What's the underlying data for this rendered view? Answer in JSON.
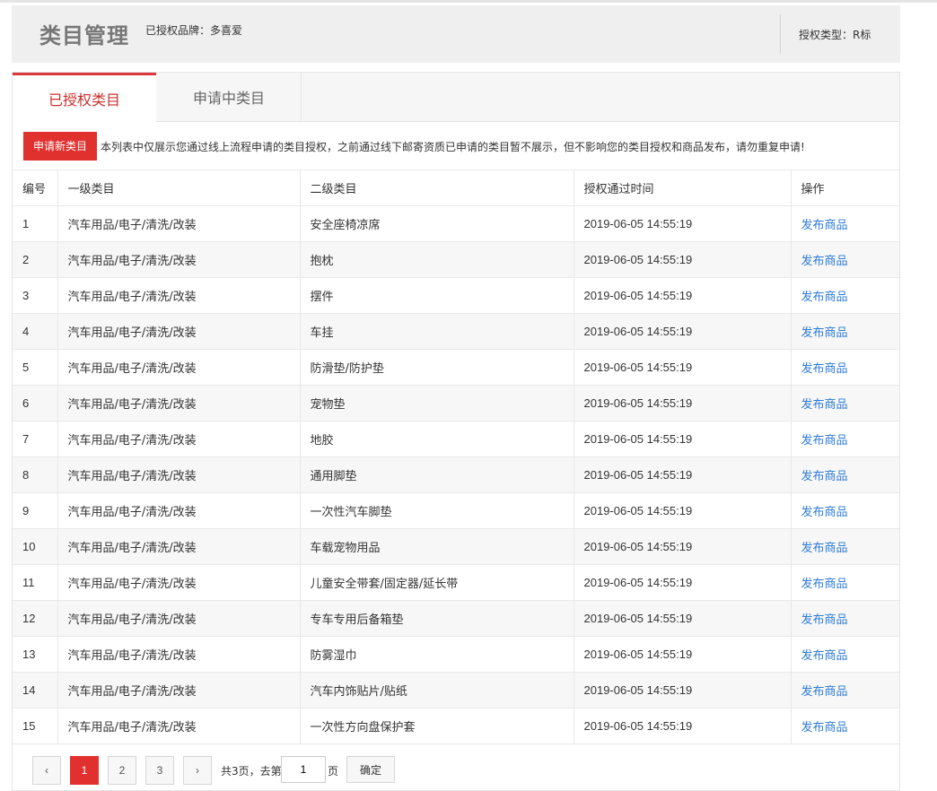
{
  "header": {
    "title": "类目管理",
    "brand_text": "已授权品牌：多喜爱",
    "auth_type_text": "授权类型：R标"
  },
  "tabs": [
    {
      "label": "已授权类目",
      "active": true
    },
    {
      "label": "申请中类目",
      "active": false
    }
  ],
  "notice": {
    "apply_button": "申请新类目",
    "text": "本列表中仅展示您通过线上流程申请的类目授权，之前通过线下邮寄资质已申请的类目暂不展示，但不影响您的类目授权和商品发布，请勿重复申请!"
  },
  "table": {
    "headers": [
      "编号",
      "一级类目",
      "二级类目",
      "授权通过时间",
      "操作"
    ],
    "rows": [
      {
        "no": "1",
        "cat1": "汽车用品/电子/清洗/改装",
        "cat2": "安全座椅凉席",
        "time": "2019-06-05 14:55:19",
        "action": "发布商品"
      },
      {
        "no": "2",
        "cat1": "汽车用品/电子/清洗/改装",
        "cat2": "抱枕",
        "time": "2019-06-05 14:55:19",
        "action": "发布商品"
      },
      {
        "no": "3",
        "cat1": "汽车用品/电子/清洗/改装",
        "cat2": "摆件",
        "time": "2019-06-05 14:55:19",
        "action": "发布商品"
      },
      {
        "no": "4",
        "cat1": "汽车用品/电子/清洗/改装",
        "cat2": "车挂",
        "time": "2019-06-05 14:55:19",
        "action": "发布商品"
      },
      {
        "no": "5",
        "cat1": "汽车用品/电子/清洗/改装",
        "cat2": "防滑垫/防护垫",
        "time": "2019-06-05 14:55:19",
        "action": "发布商品"
      },
      {
        "no": "6",
        "cat1": "汽车用品/电子/清洗/改装",
        "cat2": "宠物垫",
        "time": "2019-06-05 14:55:19",
        "action": "发布商品"
      },
      {
        "no": "7",
        "cat1": "汽车用品/电子/清洗/改装",
        "cat2": "地胶",
        "time": "2019-06-05 14:55:19",
        "action": "发布商品"
      },
      {
        "no": "8",
        "cat1": "汽车用品/电子/清洗/改装",
        "cat2": "通用脚垫",
        "time": "2019-06-05 14:55:19",
        "action": "发布商品"
      },
      {
        "no": "9",
        "cat1": "汽车用品/电子/清洗/改装",
        "cat2": "一次性汽车脚垫",
        "time": "2019-06-05 14:55:19",
        "action": "发布商品"
      },
      {
        "no": "10",
        "cat1": "汽车用品/电子/清洗/改装",
        "cat2": "车载宠物用品",
        "time": "2019-06-05 14:55:19",
        "action": "发布商品"
      },
      {
        "no": "11",
        "cat1": "汽车用品/电子/清洗/改装",
        "cat2": "儿童安全带套/固定器/延长带",
        "time": "2019-06-05 14:55:19",
        "action": "发布商品"
      },
      {
        "no": "12",
        "cat1": "汽车用品/电子/清洗/改装",
        "cat2": "专车专用后备箱垫",
        "time": "2019-06-05 14:55:19",
        "action": "发布商品"
      },
      {
        "no": "13",
        "cat1": "汽车用品/电子/清洗/改装",
        "cat2": "防雾湿巾",
        "time": "2019-06-05 14:55:19",
        "action": "发布商品"
      },
      {
        "no": "14",
        "cat1": "汽车用品/电子/清洗/改装",
        "cat2": "汽车内饰贴片/贴纸",
        "time": "2019-06-05 14:55:19",
        "action": "发布商品"
      },
      {
        "no": "15",
        "cat1": "汽车用品/电子/清洗/改装",
        "cat2": "一次性方向盘保护套",
        "time": "2019-06-05 14:55:19",
        "action": "发布商品"
      }
    ]
  },
  "pagination": {
    "prev": "‹",
    "pages": [
      "1",
      "2",
      "3"
    ],
    "current": "1",
    "next": "›",
    "total_text": "共3页，去第",
    "input_value": "1",
    "page_suffix": "页",
    "confirm": "确定"
  },
  "colors": {
    "accent": "#e0312f",
    "link": "#2c7bd6"
  }
}
